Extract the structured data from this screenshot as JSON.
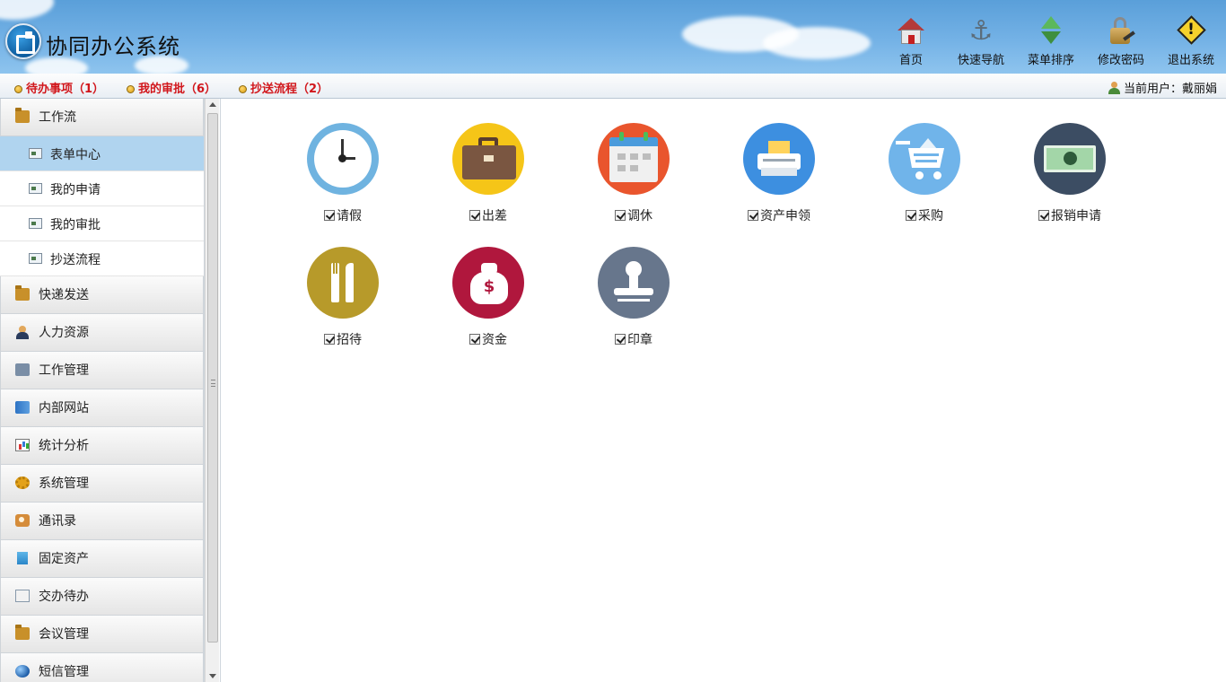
{
  "app": {
    "title": "协同办公系统"
  },
  "top_nav": [
    {
      "label": "首页",
      "icon": "home-icon"
    },
    {
      "label": "快速导航",
      "icon": "anchor-icon"
    },
    {
      "label": "菜单排序",
      "icon": "sort-icon"
    },
    {
      "label": "修改密码",
      "icon": "lock-icon"
    },
    {
      "label": "退出系统",
      "icon": "warning-icon"
    }
  ],
  "subbar": {
    "links": [
      {
        "label": "待办事项（1）"
      },
      {
        "label": "我的审批（6）"
      },
      {
        "label": "抄送流程（2）"
      }
    ],
    "user_label": "当前用户：戴丽娟"
  },
  "sidebar": {
    "groups": [
      {
        "label": "工作流",
        "icon": "folder-icon",
        "expanded": true
      },
      {
        "label": "快递发送",
        "icon": "folder-icon"
      },
      {
        "label": "人力资源",
        "icon": "person-icon"
      },
      {
        "label": "工作管理",
        "icon": "work-icon"
      },
      {
        "label": "内部网站",
        "icon": "book-icon"
      },
      {
        "label": "统计分析",
        "icon": "chart-icon"
      },
      {
        "label": "系统管理",
        "icon": "gear-icon"
      },
      {
        "label": "通讯录",
        "icon": "contact-icon"
      },
      {
        "label": "固定资产",
        "icon": "building-icon"
      },
      {
        "label": "交办待办",
        "icon": "document-icon"
      },
      {
        "label": "会议管理",
        "icon": "folder-icon"
      },
      {
        "label": "短信管理",
        "icon": "globe-icon"
      }
    ],
    "workflow_items": [
      {
        "label": "表单中心",
        "active": true
      },
      {
        "label": "我的申请"
      },
      {
        "label": "我的审批"
      },
      {
        "label": "抄送流程"
      }
    ]
  },
  "apps": [
    {
      "label": "请假",
      "icon": "clock-icon",
      "color": "#6fb3e0",
      "checked": true
    },
    {
      "label": "出差",
      "icon": "briefcase-icon",
      "color": "#f5c518",
      "checked": true
    },
    {
      "label": "调休",
      "icon": "calendar-icon",
      "color": "#e9552d",
      "checked": true
    },
    {
      "label": "资产申领",
      "icon": "printer-icon",
      "color": "#3d8fe0",
      "checked": true
    },
    {
      "label": "采购",
      "icon": "cart-icon",
      "color": "#70b4ea",
      "checked": true
    },
    {
      "label": "报销申请",
      "icon": "money-icon",
      "color": "#3c4d63",
      "checked": true
    },
    {
      "label": "招待",
      "icon": "cutlery-icon",
      "color": "#b79a2a",
      "checked": true
    },
    {
      "label": "资金",
      "icon": "money-bag-icon",
      "color": "#b0173d",
      "checked": true
    },
    {
      "label": "印章",
      "icon": "stamp-icon",
      "color": "#67768c",
      "checked": true
    }
  ]
}
